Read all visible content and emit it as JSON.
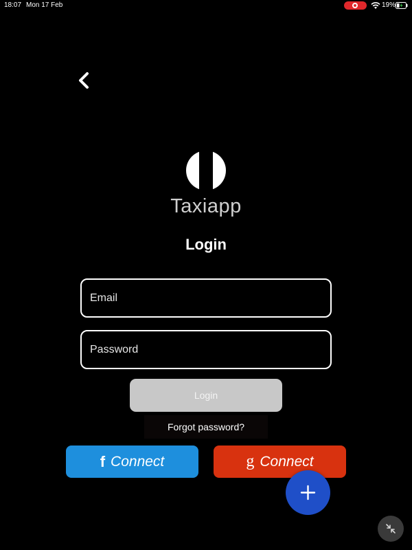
{
  "status_bar": {
    "time": "18:07",
    "date": "Mon 17 Feb",
    "battery_percent": "19%",
    "recording_color": "#e0282b"
  },
  "navigation": {
    "back_icon": "chevron-left-icon"
  },
  "brand": {
    "logo_icon": "taxiapp-logo-icon",
    "name": "Taxiapp"
  },
  "page": {
    "title": "Login"
  },
  "form": {
    "email": {
      "placeholder": "Email",
      "value": ""
    },
    "password": {
      "placeholder": "Password",
      "value": ""
    },
    "login_label": "Login",
    "forgot_label": "Forgot password?"
  },
  "social": {
    "facebook": {
      "glyph": "f",
      "label": "Connect",
      "color": "#1e8fdd"
    },
    "google": {
      "glyph": "g",
      "label": "Connect",
      "color": "#d8320f"
    }
  },
  "fab": {
    "icon": "plus-icon",
    "color": "#1f4fc8"
  },
  "overlay": {
    "icon": "collapse-icon"
  }
}
